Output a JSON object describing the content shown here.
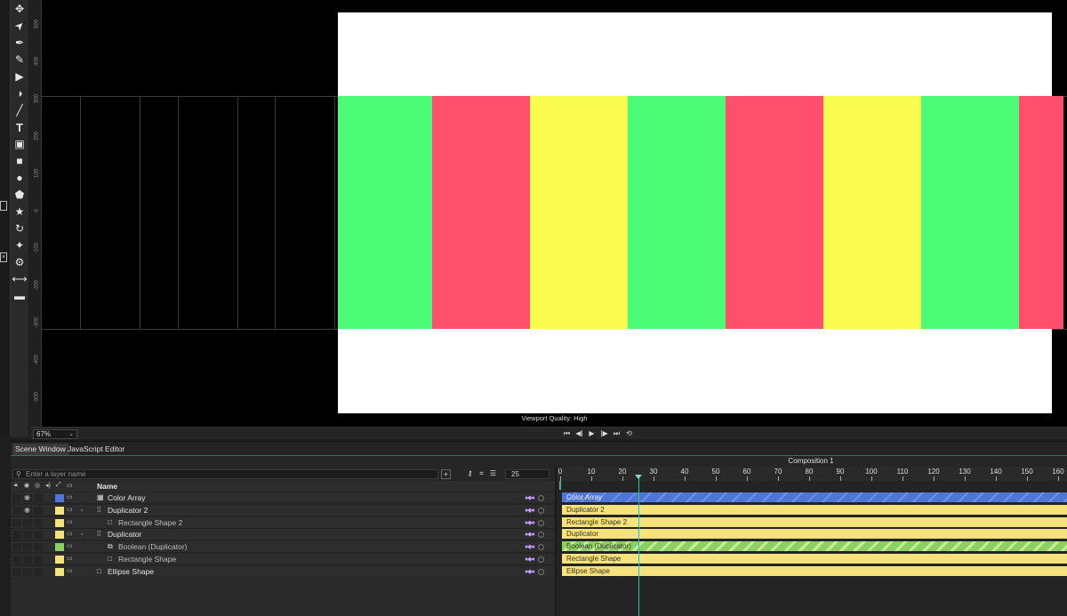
{
  "toolbar": {
    "tools": [
      "move-icon",
      "select-arrow-icon",
      "pen-icon",
      "pencil-icon",
      "camera-icon",
      "fill-icon",
      "line-icon",
      "text-icon",
      "image-icon",
      "rectangle-icon",
      "ellipse-icon",
      "polygon-icon",
      "star-icon",
      "spiral-icon",
      "sparkle-icon",
      "gear-icon",
      "resize-icon",
      "bar-icon"
    ]
  },
  "ruler": {
    "labels": [
      "500",
      "400",
      "300",
      "200",
      "100",
      "0",
      "-100",
      "-200",
      "-300",
      "-400",
      "-500"
    ]
  },
  "viewport": {
    "quality_label": "Viewport Quality: High",
    "zoom": "67%",
    "colors": {
      "green": "#4cfb76",
      "red": "#ff4f6c",
      "yellow": "#f9fb4f",
      "canvas": "#ffffff"
    },
    "stripe_pattern": [
      "green",
      "red",
      "yellow",
      "green",
      "red",
      "yellow",
      "green",
      "red"
    ]
  },
  "transport": {
    "buttons": [
      "skip-start-icon",
      "step-back-icon",
      "play-icon",
      "step-forward-icon",
      "skip-end-icon",
      "loop-icon"
    ]
  },
  "tabs": [
    {
      "label": "Scene Window",
      "active": true
    },
    {
      "label": "JavaScript Editor",
      "active": false
    }
  ],
  "layers_panel": {
    "search_placeholder": "Enter a layer name",
    "fps": "25",
    "name_header": "Name",
    "layers": [
      {
        "name": "Color Array",
        "color": "#4d76d6",
        "icon": "array-icon",
        "indent": 0,
        "expandable": false
      },
      {
        "name": "Duplicator 2",
        "color": "#f5e27a",
        "icon": "duplicator-icon",
        "indent": 0,
        "expandable": true
      },
      {
        "name": "Rectangle Shape 2",
        "color": "#f5e27a",
        "icon": "rectangle-shape-icon",
        "indent": 1,
        "expandable": false
      },
      {
        "name": "Duplicator",
        "color": "#f5e27a",
        "icon": "duplicator-icon",
        "indent": 0,
        "expandable": true
      },
      {
        "name": "Boolean (Duplicator)",
        "color": "#8ccf63",
        "icon": "boolean-icon",
        "indent": 1,
        "expandable": false
      },
      {
        "name": "Rectangle Shape",
        "color": "#f5e27a",
        "icon": "rectangle-shape-icon",
        "indent": 1,
        "expandable": false
      },
      {
        "name": "Ellipse Shape",
        "color": "#f5e27a",
        "icon": "ellipse-shape-icon",
        "indent": 0,
        "expandable": false
      }
    ]
  },
  "timeline": {
    "title": "Composition 1",
    "ticks": [
      "0",
      "10",
      "20",
      "30",
      "40",
      "50",
      "60",
      "70",
      "80",
      "90",
      "100",
      "110",
      "120",
      "130",
      "140",
      "150",
      "160"
    ],
    "playhead_frame": 25,
    "tracks": [
      {
        "label": "Color Array",
        "style": "blue"
      },
      {
        "label": "Duplicator 2",
        "style": "yellow"
      },
      {
        "label": "Rectangle Shape 2",
        "style": "yellow"
      },
      {
        "label": "Duplicator",
        "style": "yellow"
      },
      {
        "label": "Boolean (Duplicator)",
        "style": "green"
      },
      {
        "label": "Rectangle Shape",
        "style": "yellow"
      },
      {
        "label": "Ellipse Shape",
        "style": "yellow"
      }
    ]
  }
}
